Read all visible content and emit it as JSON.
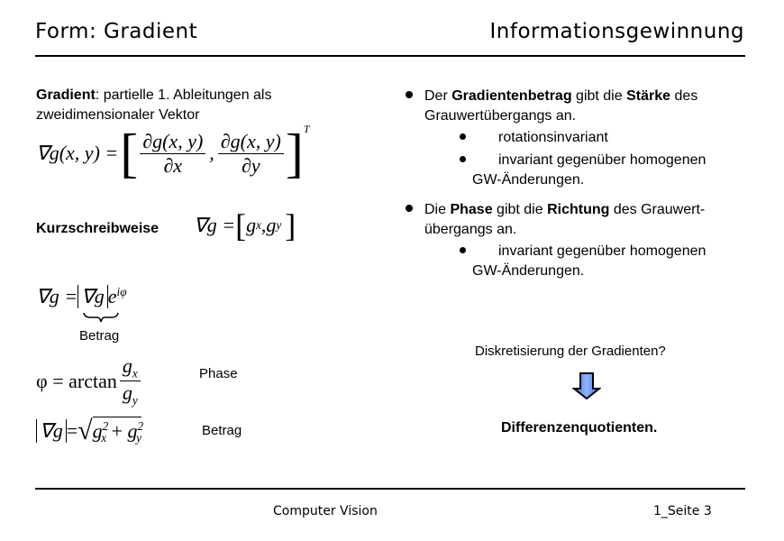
{
  "header": {
    "title_left": "Form: Gradient",
    "title_right": "Informationsgewinnung"
  },
  "left": {
    "intro_bold": "Gradient",
    "intro_rest": ": partielle 1. Ableitungen als",
    "intro_line2": "zweidimensionaler Vektor",
    "formula_gradient": {
      "lhs": "∇g(x, y) =",
      "num1": "∂g(x, y)",
      "den1": "∂x",
      "num2": "∂g(x, y)",
      "den2": "∂y",
      "sep": ",",
      "transpose": "T"
    },
    "short_label": "Kurzschreibweise",
    "formula_short": {
      "lhs": "∇g = ",
      "gx": "g",
      "gx_sub": "x",
      "sep": ", ",
      "gy": "g",
      "gy_sub": "y"
    },
    "formula_polar": {
      "lhs": "∇g = ",
      "abs": "∇g",
      "exp_base": "e",
      "exp": "iφ"
    },
    "betrag_brace_label": "Betrag",
    "formula_phase": {
      "lhs": "φ = arctan",
      "num": "g",
      "num_sub": "x",
      "den": "g",
      "den_sub": "y"
    },
    "phase_label": "Phase",
    "formula_magnitude": {
      "lhs": "∇g",
      "eq": " = ",
      "gx": "g",
      "gx_sub": "x",
      "gy": "g",
      "gy_sub": "y",
      "pow": "2",
      "plus": " + "
    },
    "magnitude_label": "Betrag"
  },
  "right": {
    "bullet1": {
      "p1": "Der ",
      "b1": "Gradientenbetrag",
      "p2": " gibt die ",
      "b2": "Stärke",
      "p3": " des",
      "line2": "Grauwertübergangs an.",
      "sub1": "rotationsinvariant",
      "sub2": "invariant gegenüber homogenen",
      "sub2_cont": "GW-Änderungen."
    },
    "bullet2": {
      "p1": "Die ",
      "b1": "Phase",
      "p2": " gibt die ",
      "b2": "Richtung",
      "p3": " des Grauwert-",
      "line2": "übergangs an.",
      "sub1": "invariant gegenüber homogenen",
      "sub1_cont": "GW-Änderungen."
    },
    "question": "Diskretisierung der Gradienten?",
    "arrow_icon": "down-arrow-icon",
    "arrow_color": "#5b8ff0",
    "answer": "Differenzenquotienten."
  },
  "footer": {
    "course": "Computer Vision",
    "page": "1_Seite 3"
  }
}
